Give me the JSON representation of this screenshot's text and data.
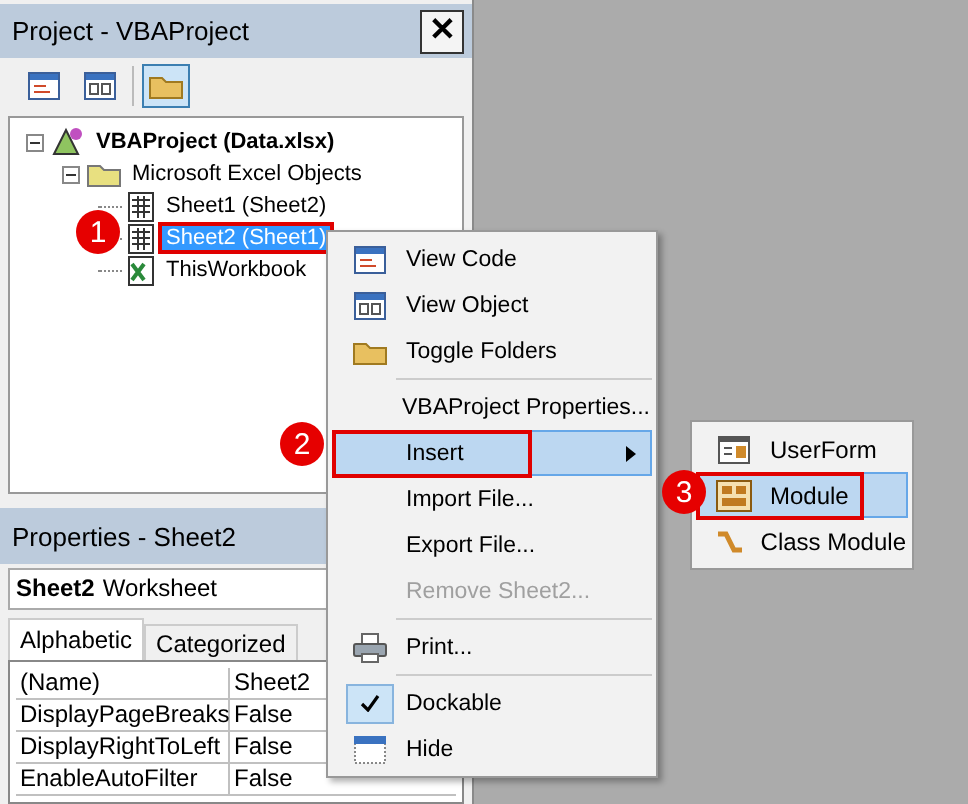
{
  "project_pane": {
    "title": "Project - VBAProject",
    "close": "✕",
    "toolbar": [
      {
        "pressed": false
      },
      {
        "pressed": false
      },
      {
        "pressed": true
      }
    ],
    "tree": [
      {
        "label": "VBAProject (Data.xlsx)",
        "kind": "project",
        "expanded": true,
        "selected": false,
        "outlined": false,
        "children": [
          {
            "label": "Microsoft Excel Objects",
            "kind": "folder",
            "expanded": true,
            "selected": false,
            "outlined": false,
            "children": [
              {
                "label": "Sheet1 (Sheet2)",
                "kind": "sheet",
                "selected": false,
                "outlined": false
              },
              {
                "label": "Sheet2 (Sheet1)",
                "kind": "sheet",
                "selected": true,
                "outlined": true
              },
              {
                "label": "ThisWorkbook",
                "kind": "workbook",
                "selected": false,
                "outlined": false
              }
            ]
          }
        ]
      }
    ]
  },
  "properties_pane": {
    "title": "Properties - Sheet2",
    "object_name": "Sheet2",
    "object_type": "Worksheet",
    "tabs": [
      {
        "label": "Alphabetic",
        "selected": true
      },
      {
        "label": "Categorized",
        "selected": false
      }
    ],
    "rows": [
      {
        "name": "(Name)",
        "value": "Sheet2"
      },
      {
        "name": "DisplayPageBreaks",
        "value": "False"
      },
      {
        "name": "DisplayRightToLeft",
        "value": "False"
      },
      {
        "name": "EnableAutoFilter",
        "value": "False"
      }
    ]
  },
  "context_menu": {
    "groups": [
      [
        {
          "label": "View Code",
          "selected": false,
          "disabled": false,
          "checked": false,
          "outlined": false,
          "submenu": false
        },
        {
          "label": "View Object",
          "selected": false,
          "disabled": false,
          "checked": false,
          "outlined": false,
          "submenu": false
        },
        {
          "label": "Toggle Folders",
          "selected": false,
          "disabled": false,
          "checked": false,
          "outlined": false,
          "submenu": false
        }
      ],
      [
        {
          "label": "VBAProject Properties...",
          "selected": false,
          "disabled": false,
          "checked": false,
          "outlined": false,
          "submenu": false
        },
        {
          "label": "Insert",
          "selected": true,
          "disabled": false,
          "checked": false,
          "outlined": true,
          "submenu": true
        },
        {
          "label": "Import File...",
          "selected": false,
          "disabled": false,
          "checked": false,
          "outlined": false,
          "submenu": false
        },
        {
          "label": "Export File...",
          "selected": false,
          "disabled": false,
          "checked": false,
          "outlined": false,
          "submenu": false
        },
        {
          "label": "Remove Sheet2...",
          "selected": false,
          "disabled": true,
          "checked": false,
          "outlined": false,
          "submenu": false
        }
      ],
      [
        {
          "label": "Print...",
          "selected": false,
          "disabled": false,
          "checked": false,
          "outlined": false,
          "submenu": false
        }
      ],
      [
        {
          "label": "Dockable",
          "selected": false,
          "disabled": false,
          "checked": true,
          "outlined": false,
          "submenu": false
        },
        {
          "label": "Hide",
          "selected": false,
          "disabled": false,
          "checked": false,
          "outlined": false,
          "submenu": false
        }
      ]
    ]
  },
  "submenu": [
    {
      "label": "UserForm",
      "selected": false,
      "outlined": false
    },
    {
      "label": "Module",
      "selected": true,
      "outlined": true
    },
    {
      "label": "Class Module",
      "selected": false,
      "outlined": false
    }
  ],
  "callouts": [
    {
      "label": "1"
    },
    {
      "label": "2"
    },
    {
      "label": "3"
    }
  ]
}
